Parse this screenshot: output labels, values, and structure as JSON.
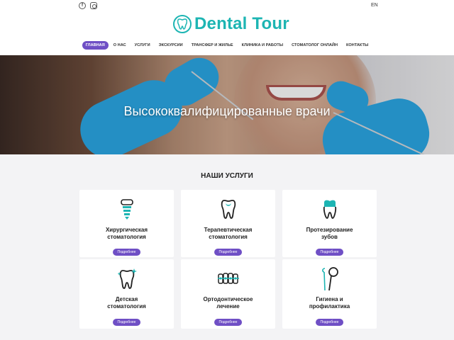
{
  "topbar": {
    "lang": "EN",
    "facebook_glyph": "f"
  },
  "brand": {
    "name": "Dental Tour",
    "color": "#1db5b3"
  },
  "nav": {
    "items": [
      {
        "label": "ГЛАВНАЯ"
      },
      {
        "label": "О НАС"
      },
      {
        "label": "УСЛУГИ"
      },
      {
        "label": "ЭКСКУРСИИ"
      },
      {
        "label": "ТРАНСФЕР И ЖИЛЬЕ"
      },
      {
        "label": "КЛИНИКА И РАБОТЫ"
      },
      {
        "label": "СТОМАТОЛОГ ОНЛАЙН"
      },
      {
        "label": "КОНТАКТЫ"
      }
    ],
    "active_color": "#6f4fc5"
  },
  "hero": {
    "title": "Высококвалифицированные врачи"
  },
  "services": {
    "title": "НАШИ УСЛУГИ",
    "button_label": "Подробнее",
    "cards": [
      {
        "line1": "Хирургическая",
        "line2": "стоматология",
        "icon": "implant-icon"
      },
      {
        "line1": "Терапевтическая",
        "line2": "стоматология",
        "icon": "filled-tooth-icon"
      },
      {
        "line1": "Протезирование",
        "line2": "зубов",
        "icon": "crown-icon"
      },
      {
        "line1": "Детская",
        "line2": "стоматология",
        "icon": "sparkle-tooth-icon"
      },
      {
        "line1": "Ортодонтическое",
        "line2": "лечение",
        "icon": "braces-icon"
      },
      {
        "line1": "Гигиена и",
        "line2": "профилактика",
        "icon": "dental-mirror-icon"
      }
    ]
  }
}
